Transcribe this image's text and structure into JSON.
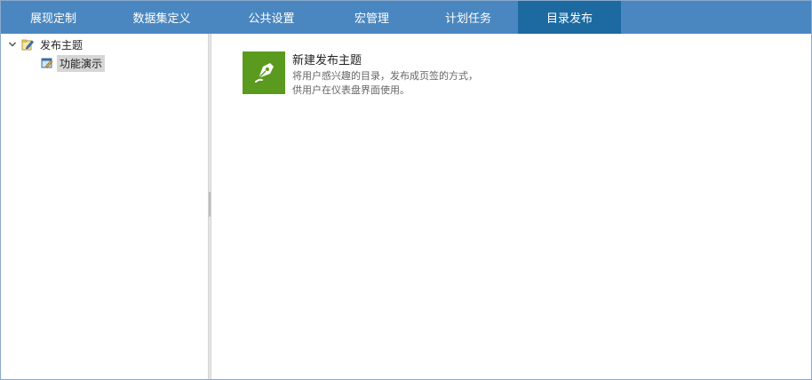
{
  "nav": {
    "tabs": [
      {
        "label": "展现定制"
      },
      {
        "label": "数据集定义"
      },
      {
        "label": "公共设置"
      },
      {
        "label": "宏管理"
      },
      {
        "label": "计划任务"
      },
      {
        "label": "目录发布"
      }
    ],
    "active_index": 5
  },
  "tree": {
    "root_label": "发布主题",
    "child_label": "功能演示"
  },
  "card": {
    "title": "新建发布主题",
    "desc_line1": "将用户感兴趣的目录，发布成页签的方式，",
    "desc_line2": "供用户在仪表盘界面使用。"
  },
  "colors": {
    "nav_bg": "#4a87c0",
    "nav_active": "#1d6aa0",
    "card_icon": "#5a9a1e"
  },
  "icons": [
    "chevron-down-icon",
    "folder-edit-icon",
    "document-edit-icon",
    "pen-nib-icon",
    "splitter-handle-icon"
  ]
}
